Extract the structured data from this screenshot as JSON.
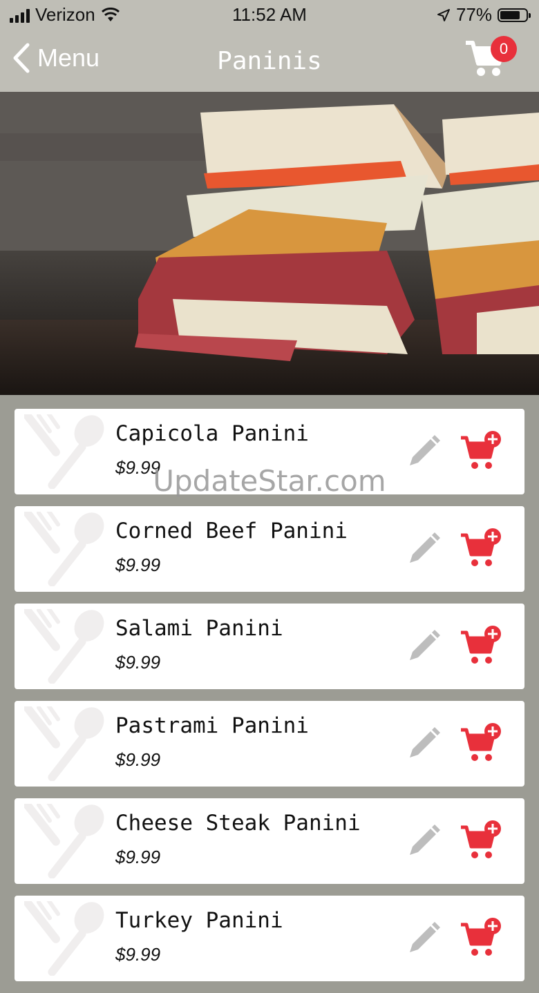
{
  "status_bar": {
    "carrier": "Verizon",
    "time": "11:52 AM",
    "battery": "77%"
  },
  "nav": {
    "back_label": "Menu",
    "title": "Paninis",
    "cart_count": "0"
  },
  "items": [
    {
      "name": "Capicola Panini",
      "price": "$9.99"
    },
    {
      "name": "Corned Beef Panini",
      "price": "$9.99"
    },
    {
      "name": "Salami Panini",
      "price": "$9.99"
    },
    {
      "name": "Pastrami Panini",
      "price": "$9.99"
    },
    {
      "name": "Cheese Steak Panini",
      "price": "$9.99"
    },
    {
      "name": "Turkey Panini",
      "price": "$9.99"
    }
  ],
  "watermark": "UpdateStar.com",
  "colors": {
    "accent": "#e8303b",
    "nav_bg": "#bfbeb6",
    "list_bg": "#9c9c94",
    "edit_icon": "#bdbdbd"
  }
}
